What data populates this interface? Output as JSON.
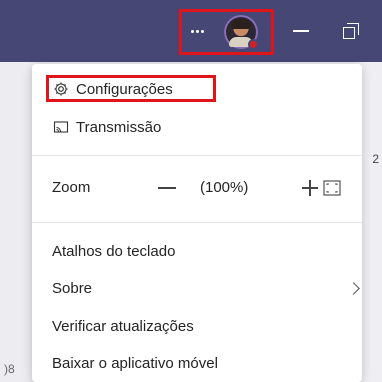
{
  "menu": {
    "settings_label": "Configurações",
    "cast_label": "Transmissão",
    "zoom_label": "Zoom",
    "zoom_value": "(100%)",
    "shortcuts_label": "Atalhos do teclado",
    "about_label": "Sobre",
    "updates_label": "Verificar atualizações",
    "mobile_label": "Baixar o aplicativo móvel"
  },
  "background": {
    "left_number": ")8",
    "right_badge": "2"
  },
  "colors": {
    "titlebar": "#464775",
    "highlight": "#e0151b",
    "presence_busy": "#d41f26"
  },
  "icons": {
    "more": "more-icon",
    "avatar": "avatar",
    "minimize": "minimize-icon",
    "restore": "restore-icon",
    "settings": "gear-icon",
    "cast": "cast-icon",
    "zoom_out": "minus-icon",
    "zoom_in": "plus-icon",
    "zoom_fit": "fullscreen-icon",
    "about_chevron": "chevron-right-icon"
  }
}
